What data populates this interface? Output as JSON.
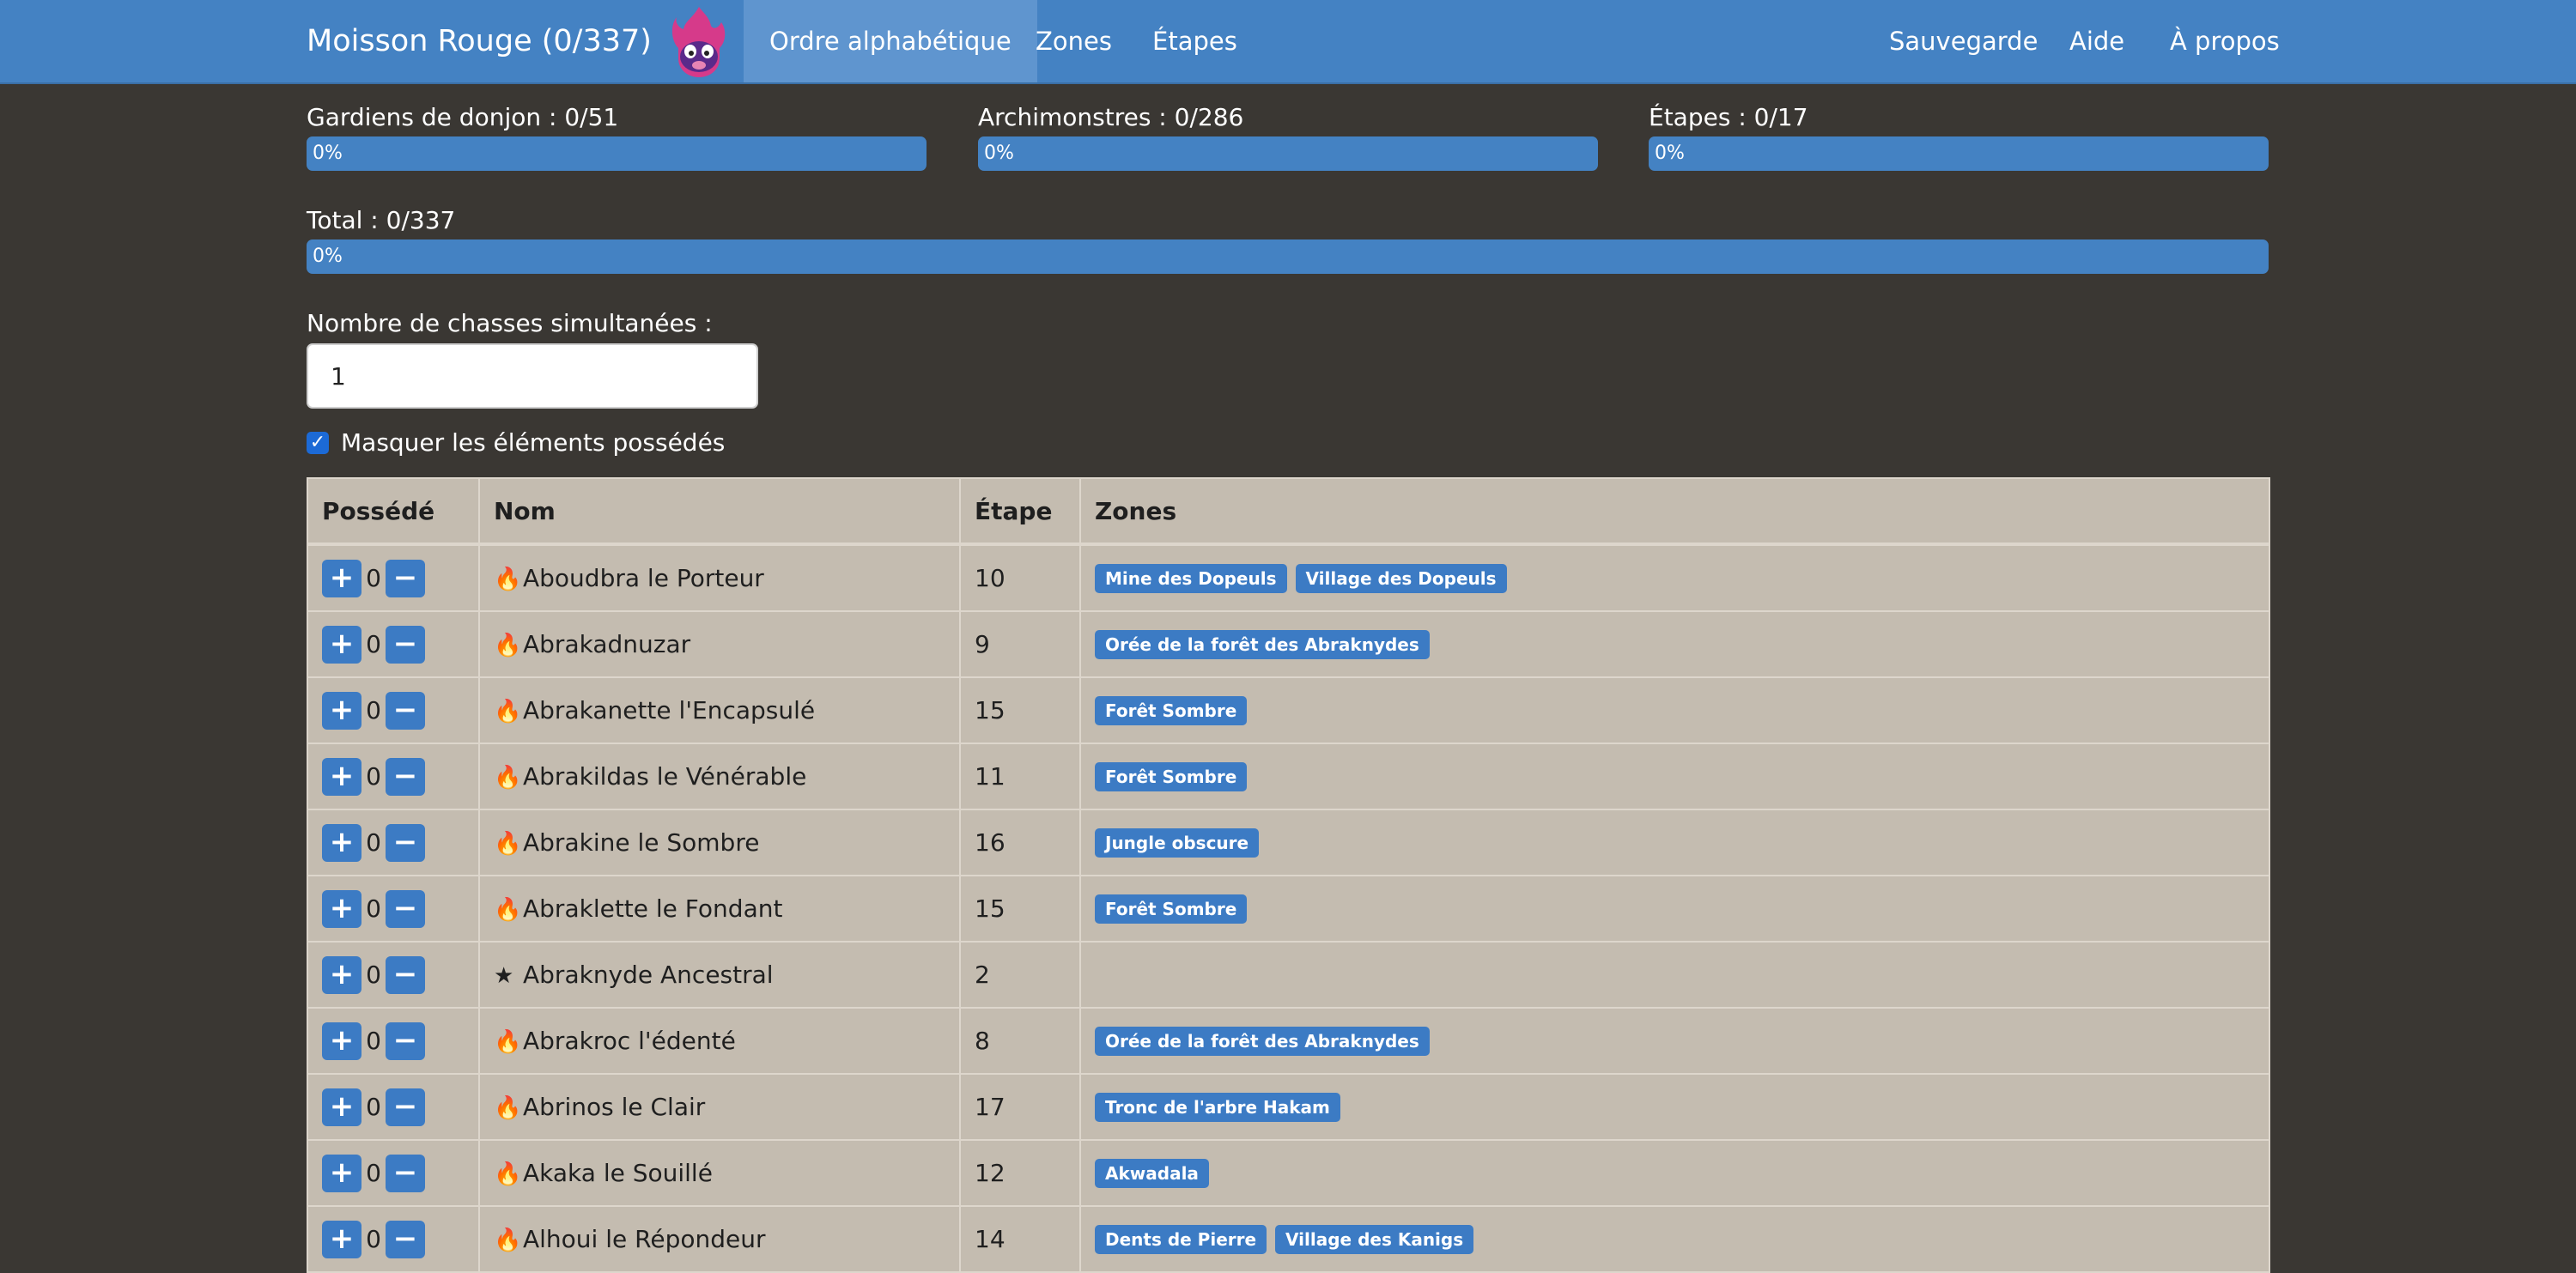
{
  "navbar": {
    "brand": "Moisson Rouge (0/337)",
    "tabs": [
      {
        "label": "Ordre alphabétique",
        "active": true
      },
      {
        "label": "Zones",
        "active": false
      },
      {
        "label": "Étapes",
        "active": false
      }
    ],
    "right": [
      {
        "label": "Sauvegarde"
      },
      {
        "label": "Aide"
      },
      {
        "label": "À propos"
      }
    ]
  },
  "progress": {
    "dungeon": {
      "label": "Gardiens de donjon : 0/51",
      "value": "0%"
    },
    "archi": {
      "label": "Archimonstres : 0/286",
      "value": "0%"
    },
    "steps": {
      "label": "Étapes : 0/17",
      "value": "0%"
    },
    "total": {
      "label": "Total : 0/337",
      "value": "0%"
    }
  },
  "hunts": {
    "label": "Nombre de chasses simultanées :",
    "value": "1"
  },
  "hide_owned": {
    "label": "Masquer les éléments possédés",
    "checked": true
  },
  "table": {
    "headers": [
      "Possédé",
      "Nom",
      "Étape",
      "Zones"
    ],
    "rows": [
      {
        "count": "0",
        "icon": "flame-icon",
        "name": "Aboudbra le Porteur",
        "step": "10",
        "zones": [
          "Mine des Dopeuls",
          "Village des Dopeuls"
        ]
      },
      {
        "count": "0",
        "icon": "flame-icon",
        "name": "Abrakadnuzar",
        "step": "9",
        "zones": [
          "Orée de la forêt des Abraknydes"
        ]
      },
      {
        "count": "0",
        "icon": "flame-icon",
        "name": "Abrakanette l'Encapsulé",
        "step": "15",
        "zones": [
          "Forêt Sombre"
        ]
      },
      {
        "count": "0",
        "icon": "flame-icon",
        "name": "Abrakildas le Vénérable",
        "step": "11",
        "zones": [
          "Forêt Sombre"
        ]
      },
      {
        "count": "0",
        "icon": "flame-icon",
        "name": "Abrakine le Sombre",
        "step": "16",
        "zones": [
          "Jungle obscure"
        ]
      },
      {
        "count": "0",
        "icon": "flame-icon",
        "name": "Abraklette le Fondant",
        "step": "15",
        "zones": [
          "Forêt Sombre"
        ]
      },
      {
        "count": "0",
        "icon": "star-icon",
        "name": "Abraknyde Ancestral",
        "step": "2",
        "zones": []
      },
      {
        "count": "0",
        "icon": "flame-icon",
        "name": "Abrakroc l'édenté",
        "step": "8",
        "zones": [
          "Orée de la forêt des Abraknydes"
        ]
      },
      {
        "count": "0",
        "icon": "flame-icon",
        "name": "Abrinos le Clair",
        "step": "17",
        "zones": [
          "Tronc de l'arbre Hakam"
        ]
      },
      {
        "count": "0",
        "icon": "flame-icon",
        "name": "Akaka le Souillé",
        "step": "12",
        "zones": [
          "Akwadala"
        ]
      },
      {
        "count": "0",
        "icon": "flame-icon",
        "name": "Alhoui le Répondeur",
        "step": "14",
        "zones": [
          "Dents de Pierre",
          "Village des Kanigs"
        ]
      }
    ]
  },
  "colors": {
    "navbar": "#4482c3",
    "background": "#3a3733",
    "table": "#c4bcb0",
    "badge": "#3c7bc4"
  },
  "icons": {
    "plus": "+",
    "minus": "−",
    "flame": "🔥",
    "star": "★"
  }
}
